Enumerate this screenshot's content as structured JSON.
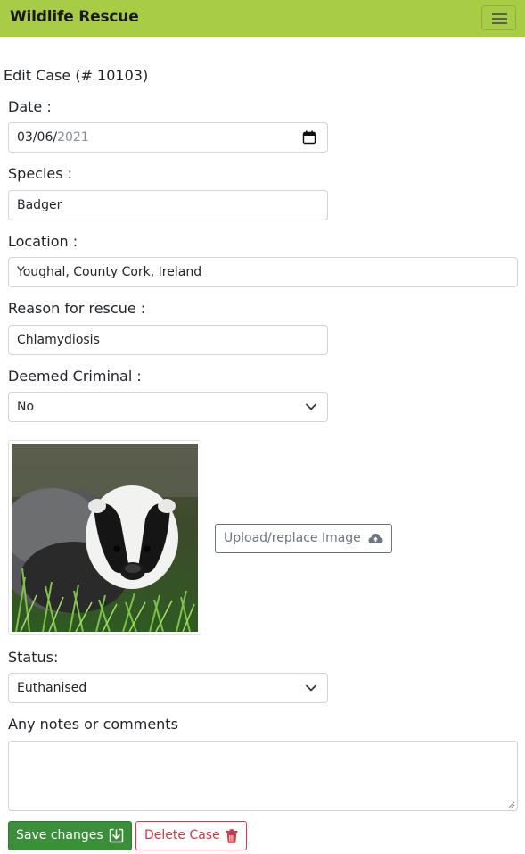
{
  "navbar": {
    "brand": "Wildlife Rescue",
    "menu_icon": "hamburger-menu-icon"
  },
  "form": {
    "title": "Edit Case (# 10103)",
    "date": {
      "label": "Date :",
      "value_day_month": "03/06/",
      "value_year": "2021",
      "icon": "calendar-icon"
    },
    "species": {
      "label": "Species :",
      "value": "Badger"
    },
    "location": {
      "label": "Location :",
      "value": "Youghal, County Cork, Ireland"
    },
    "reason": {
      "label": "Reason for rescue :",
      "value": "Chlamydiosis"
    },
    "criminal": {
      "label": "Deemed Criminal :",
      "selected": "No",
      "icon": "chevron-down-icon"
    },
    "image": {
      "subject": "badger photo",
      "upload_label": "Upload/replace Image",
      "upload_icon": "cloud-upload-icon"
    },
    "status": {
      "label": "Status:",
      "selected": "Euthanised",
      "icon": "chevron-down-icon"
    },
    "notes": {
      "label": "Any notes or comments",
      "value": ""
    }
  },
  "actions": {
    "save_label": "Save changes",
    "save_icon": "save-download-icon",
    "delete_label": "Delete Case",
    "delete_icon": "trash-icon"
  },
  "colors": {
    "navbar_bg": "#a9cc47",
    "save_bg": "#3c8f3a",
    "delete": "#dc3545",
    "secondary": "#6c757d"
  }
}
